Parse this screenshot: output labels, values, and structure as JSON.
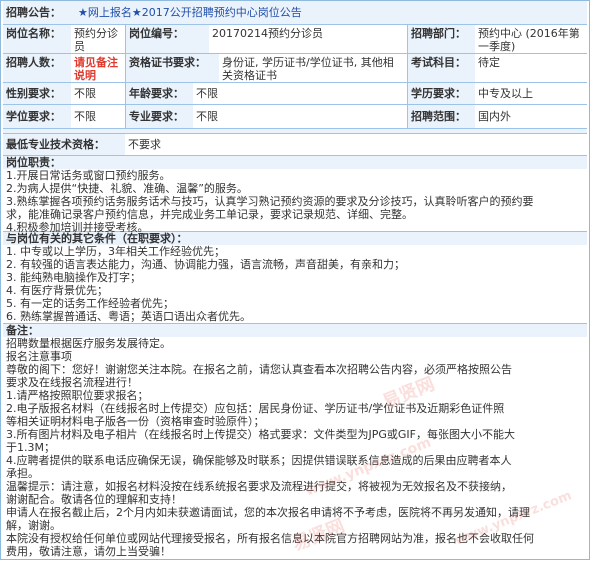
{
  "header": {
    "label": "招聘公告：",
    "title": "★网上报名★2017公开招聘预约中心岗位公告"
  },
  "row1": {
    "name_label": "岗位名称：",
    "name_value": "预约分诊员",
    "code_label": "岗位编号：",
    "code_value": "20170214预约分诊员",
    "dept_label": "招聘部门：",
    "dept_value": "预约中心 (2016年第一季度)"
  },
  "row2": {
    "count_label": "招聘人数：",
    "count_value": "请见备注说明",
    "cert_label": "资格证书要求：",
    "cert_value": "身份证, 学历证书/学位证书, 其他相关资格证书",
    "exam_label": "考试科目：",
    "exam_value": "待定"
  },
  "row3": {
    "gender_label": "性别要求：",
    "gender_value": "不限",
    "age_label": "年龄要求：",
    "age_value": "不限",
    "edu_label": "学历要求：",
    "edu_value": "中专及以上"
  },
  "row4": {
    "degree_label": "学位要求：",
    "degree_value": "不限",
    "major_label": "专业要求：",
    "major_value": "不限",
    "range_label": "招聘范围：",
    "range_value": "国内外"
  },
  "row5": {
    "skill_label": "最低专业技术资格：",
    "skill_value": "不要求"
  },
  "duties": {
    "heading": "岗位职责：",
    "lines": [
      "1.开展日常话务或窗口预约服务。",
      "2.为病人提供“快捷、礼貌、准确、温馨”的服务。",
      "3.熟练掌握各项预约话务服务话术与技巧，认真学习熟记预约资源的要求及分诊技巧，认真聆听客户的预约要",
      "求，能准确记录客户预约信息，并完成业务工单记录，要求记录规范、详细、完整。",
      "4.积极参加培训并接受考核。"
    ]
  },
  "conditions": {
    "heading": "与岗位有关的其它条件（在职要求）：",
    "lines": [
      "1. 中专或以上学历，3年相关工作经验优先；",
      "2. 有较强的语言表达能力，沟通、协调能力强，语言流畅，声音甜美，有亲和力；",
      "3. 能纯熟电脑操作及打字；",
      "4. 有医疗背景优先；",
      "5. 有一定的话务工作经验者优先；",
      "6. 熟练掌握普通话、粤语；英语口语出众者优先。"
    ]
  },
  "notes": {
    "heading": "备注：",
    "lines": [
      "招聘数量根据医疗服务发展待定。",
      "报名注意事项",
      "    尊敬的阁下：您好！谢谢您关注本院。在报名之前，请您认真查看本次招聘公告内容，必须严格按照公告",
      "要求及在线报名流程进行！",
      "      1.请严格按照职位要求报名；",
      "      2.电子版报名材料（在线报名时上传提交）应包括：居民身份证、学历证书/学位证书及近期彩色证件照",
      "等相关证明材料电子版各一份（资格审查时验原件）；",
      "      3.所有图片材料及电子相片（在线报名时上传提交）格式要求：文件类型为JPG或GIF，每张图大小不能大",
      "于1.3M；",
      "      4.应聘者提供的联系电话应确保无误，确保能够及时联系；因提供错误联系信息造成的后果由应聘者本人",
      "承担。",
      "    温馨提示：请注意，如报名材料没按在线系统报名要求及流程进行提交，将被视为无效报名及不获接纳，",
      "谢谢配合。敬请各位的理解和支持！",
      "申请人在报名截止后，2个月内如未获邀请面试，您的本次报名申请将不予考虑，医院将不再另发通知，请理",
      "解，谢谢。",
      "本院没有授权给任何单位或网站代理接受报名，所有报名信息以本院官方招聘网站为准，报名也不会收取任何",
      "费用，敬请注意，请勿上当受骗！"
    ]
  },
  "watermark": [
    "易贤网",
    "www.ynpxrz.com",
    "易贤网",
    "www.ynpxrz.com"
  ]
}
